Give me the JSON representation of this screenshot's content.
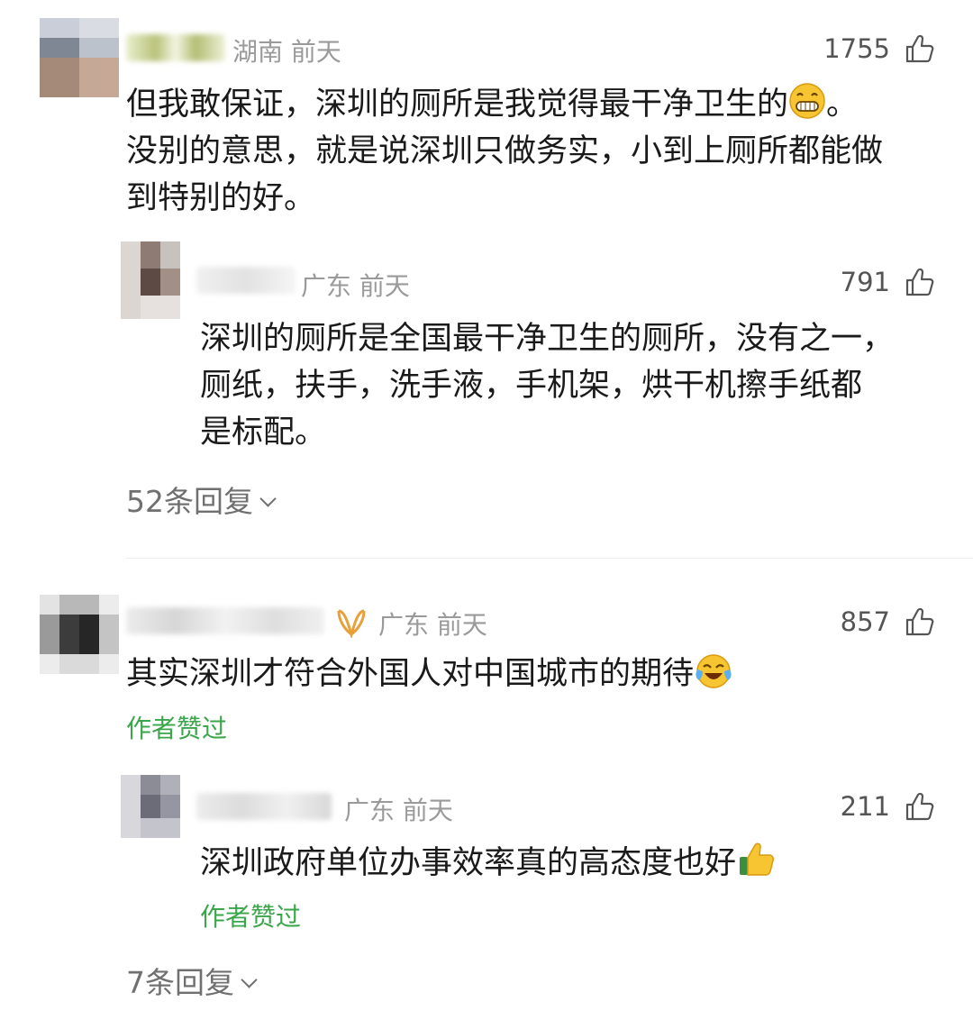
{
  "comments": [
    {
      "location_time": "湖南 前天",
      "likes": "1755",
      "text": "但我敢保证，深圳的厕所是我觉得最干净卫生的",
      "text_after_emoji": "。",
      "text_line2": "没别的意思，就是说深圳只做务实，小到上厕所都能做",
      "text_line3": "到特别的好。",
      "emoji": "grinning-face"
    },
    {
      "location_time": "广东 前天",
      "likes": "791",
      "text_line1": "深圳的厕所是全国最干净卫生的厕所，没有之一，",
      "text_line2": "厕纸，扶手，洗手液，手机架，烘干机擦手纸都",
      "text_line3": "是标配。"
    },
    {
      "replies_label": "52条回复"
    },
    {
      "location_time": "广东 前天",
      "likes": "857",
      "text": "其实深圳才符合外国人对中国城市的期待",
      "emoji": "tears-of-joy",
      "author_liked": "作者赞过"
    },
    {
      "location_time": "广东 前天",
      "likes": "211",
      "text": "深圳政府单位办事效率真的高态度也好",
      "emoji": "thumbs-up",
      "author_liked": "作者赞过"
    },
    {
      "replies_label": "7条回复"
    }
  ],
  "colors": {
    "accent_green": "#3aa64a",
    "muted_text": "#9a9a9a",
    "badge_orange": "#e8a03a"
  }
}
